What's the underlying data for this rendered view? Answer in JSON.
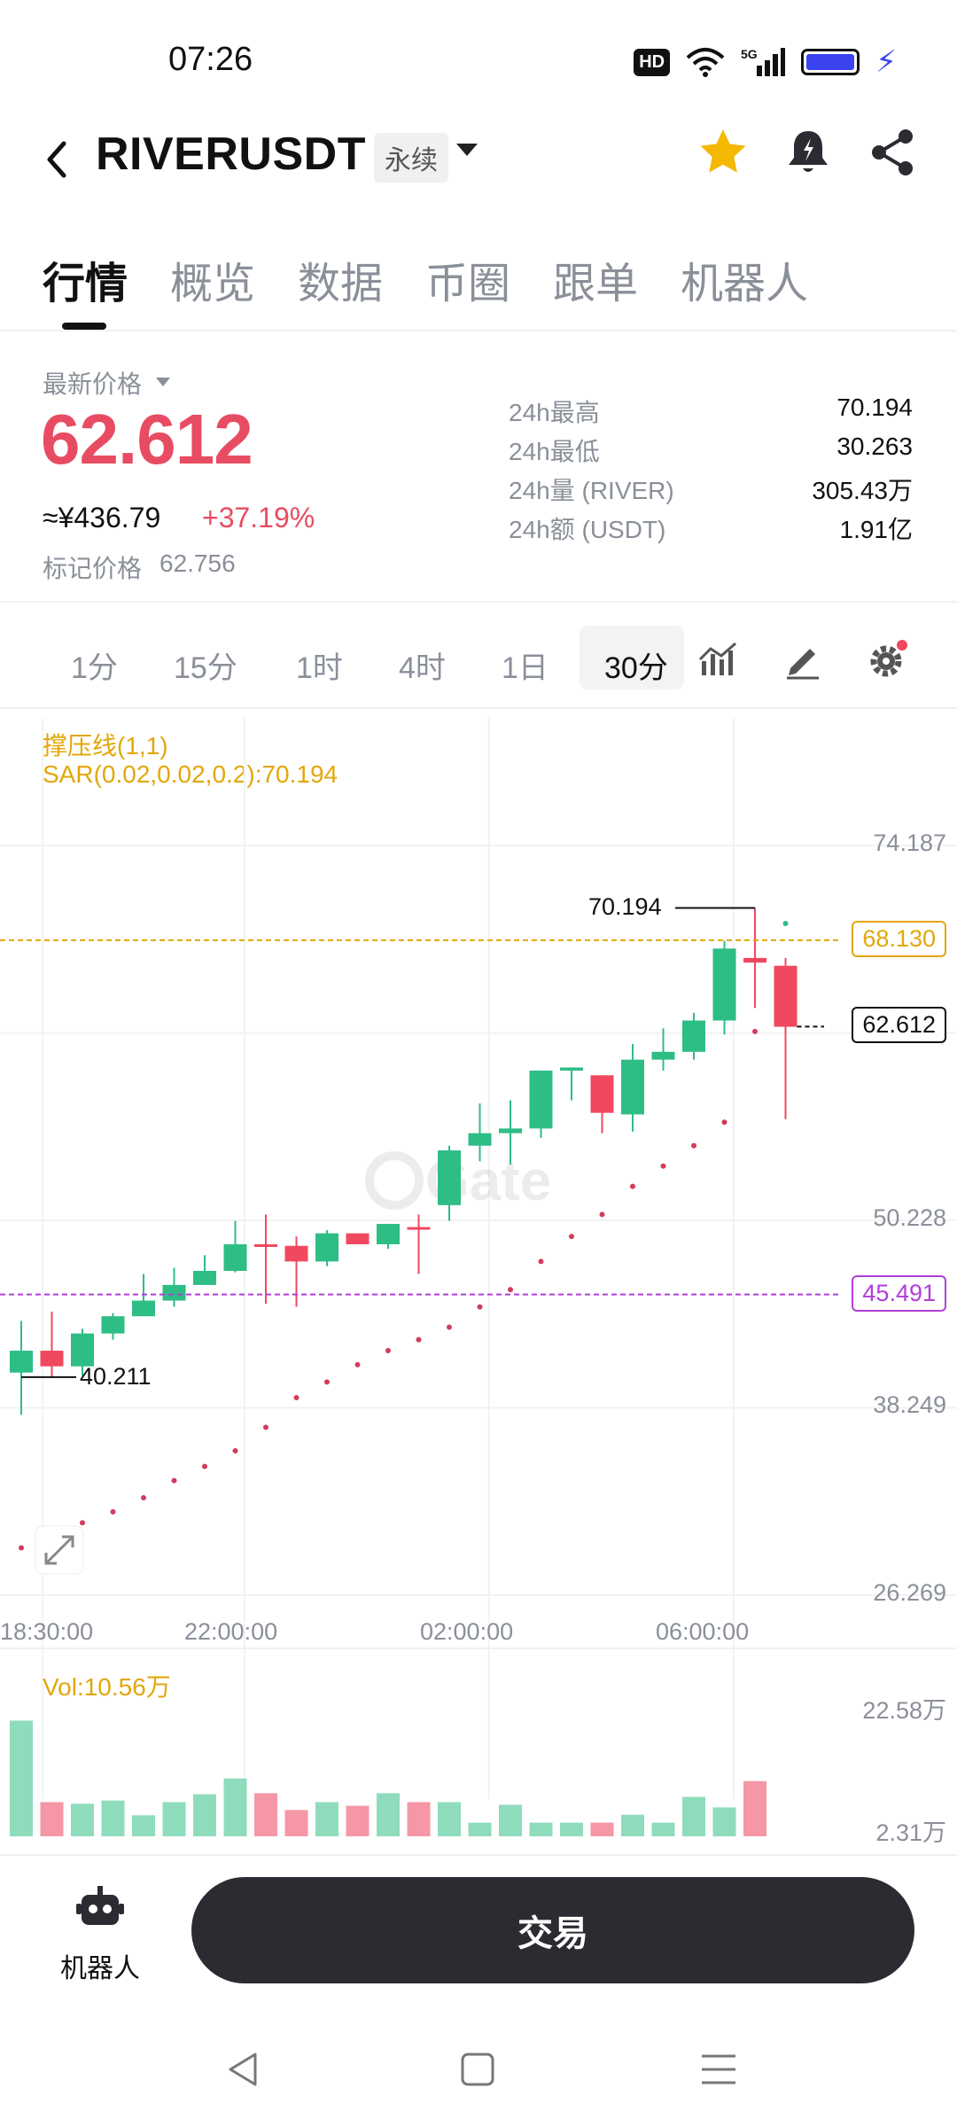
{
  "status_bar": {
    "time": "07:26",
    "hd": "HD",
    "net": "5G"
  },
  "header": {
    "pair": "RIVERUSDT",
    "contract_type": "永续"
  },
  "tabs": [
    {
      "label": "行情",
      "active": true
    },
    {
      "label": "概览"
    },
    {
      "label": "数据"
    },
    {
      "label": "币圈"
    },
    {
      "label": "跟单"
    },
    {
      "label": "机器人"
    }
  ],
  "price": {
    "latest_label": "最新价格",
    "last": "62.612",
    "cny": "≈¥436.79",
    "change": "+37.19%",
    "mark_label": "标记价格",
    "mark": "62.756"
  },
  "stats": [
    {
      "k": "24h最高",
      "v": "70.194"
    },
    {
      "k": "24h最低",
      "v": "30.263"
    },
    {
      "k": "24h量 (RIVER)",
      "v": "305.43万"
    },
    {
      "k": "24h额 (USDT)",
      "v": "1.91亿"
    }
  ],
  "intervals": [
    {
      "label": "1分"
    },
    {
      "label": "15分"
    },
    {
      "label": "1时"
    },
    {
      "label": "4时"
    },
    {
      "label": "1日"
    },
    {
      "label": "30分",
      "active": true
    }
  ],
  "indicators": {
    "line1": "撑压线(1,1)",
    "line2": "SAR(0.02,0.02,0.2):70.194"
  },
  "chart_data": {
    "type": "candlestick",
    "y_axis_labels": [
      "74.187",
      "50.228",
      "38.249",
      "26.269"
    ],
    "ylim": [
      26.269,
      74.187
    ],
    "x_axis_labels": [
      "18:30:00",
      "22:00:00",
      "02:00:00",
      "06:00:00"
    ],
    "candles": [
      [
        40.5,
        41.9,
        37.8,
        43.8
      ],
      [
        41.9,
        40.9,
        40.2,
        44.4
      ],
      [
        40.9,
        43.0,
        40.3,
        43.3
      ],
      [
        43.0,
        44.1,
        42.6,
        44.3
      ],
      [
        44.1,
        45.1,
        44.1,
        46.8
      ],
      [
        45.1,
        46.1,
        44.7,
        47.2
      ],
      [
        46.1,
        47.0,
        46.1,
        48.0
      ],
      [
        47.0,
        48.7,
        46.9,
        50.2
      ],
      [
        48.7,
        48.6,
        44.9,
        50.6
      ],
      [
        48.6,
        47.6,
        44.7,
        49.2
      ],
      [
        47.6,
        49.4,
        47.3,
        49.6
      ],
      [
        49.4,
        48.7,
        48.7,
        49.4
      ],
      [
        48.7,
        50.0,
        48.4,
        50.0
      ],
      [
        49.8,
        49.7,
        46.8,
        50.6
      ],
      [
        51.2,
        54.7,
        50.2,
        55.0
      ],
      [
        55.0,
        55.8,
        54.0,
        57.7
      ],
      [
        55.8,
        56.1,
        53.8,
        57.9
      ],
      [
        56.1,
        59.8,
        55.5,
        59.8
      ],
      [
        59.8,
        60.0,
        57.9,
        60.0
      ],
      [
        59.5,
        57.1,
        55.8,
        59.5
      ],
      [
        57.0,
        60.5,
        55.9,
        61.5
      ],
      [
        60.5,
        61.0,
        59.8,
        62.5
      ],
      [
        61.0,
        63.0,
        60.5,
        63.5
      ],
      [
        63.0,
        67.6,
        62.1,
        68.1
      ],
      [
        67.0,
        66.7,
        63.8,
        70.2
      ],
      [
        66.5,
        62.6,
        56.7,
        67.0
      ]
    ],
    "sar": [
      29.3,
      29.7,
      30.9,
      31.6,
      32.5,
      33.6,
      34.5,
      35.5,
      37.0,
      38.9,
      39.9,
      41.0,
      41.9,
      42.6,
      43.4,
      44.7,
      45.8,
      47.6,
      49.2,
      50.6,
      52.4,
      53.7,
      55.0,
      56.5,
      62.3,
      69.2
    ],
    "annotations": [
      {
        "label": "70.194",
        "value": 70.194,
        "type": "high"
      },
      {
        "label": "40.211",
        "value": 40.211,
        "type": "low"
      }
    ],
    "price_lines": [
      {
        "label": "68.130",
        "value": 68.13,
        "color": "#e2a70a"
      },
      {
        "label": "45.491",
        "value": 45.491,
        "color": "#b13fd8"
      },
      {
        "label": "62.612",
        "value": 62.612,
        "color": "#111111"
      }
    ],
    "volume_label": "Vol:10.56万",
    "volume_axis_labels": [
      "22.58万",
      "2.31万"
    ],
    "volumes_wan": [
      22.0,
      6.5,
      6.2,
      6.8,
      4.0,
      6.5,
      8.0,
      11.0,
      8.2,
      5.0,
      6.5,
      5.8,
      8.2,
      6.5,
      6.5,
      2.6,
      6.0,
      2.6,
      2.6,
      2.6,
      4.1,
      2.6,
      7.5,
      5.5,
      10.5
    ],
    "up_color": "#2ebd85",
    "down_color": "#f0485f"
  },
  "bottom": {
    "robot_label": "机器人",
    "trade": "交易"
  }
}
